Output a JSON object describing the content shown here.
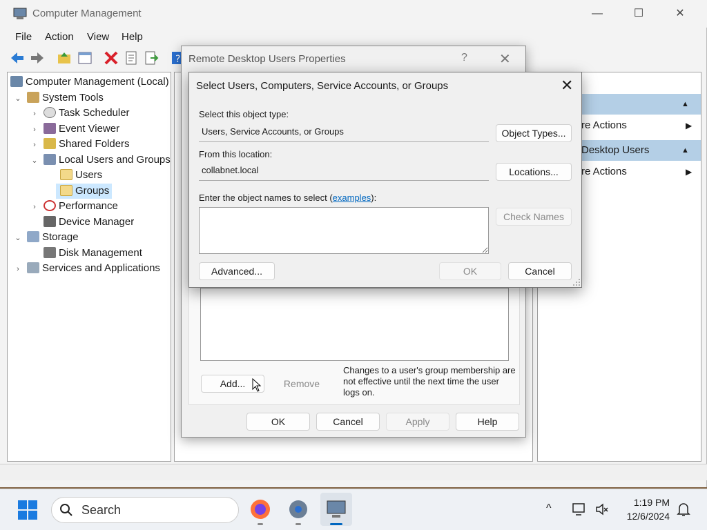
{
  "window": {
    "title": "Computer Management"
  },
  "menu": [
    "File",
    "Action",
    "View",
    "Help"
  ],
  "tree": [
    {
      "label": "Computer Management (Local)"
    },
    {
      "label": "System Tools"
    },
    {
      "label": "Task Scheduler"
    },
    {
      "label": "Event Viewer"
    },
    {
      "label": "Shared Folders"
    },
    {
      "label": "Local Users and Groups"
    },
    {
      "label": "Users"
    },
    {
      "label": "Groups"
    },
    {
      "label": "Performance"
    },
    {
      "label": "Device Manager"
    },
    {
      "label": "Storage"
    },
    {
      "label": "Disk Management"
    },
    {
      "label": "Services and Applications"
    }
  ],
  "actions": {
    "more1": "re Actions",
    "group": "Desktop Users",
    "more2": "re Actions"
  },
  "props": {
    "title": "Remote Desktop Users Properties",
    "help": "?",
    "add": "Add...",
    "remove": "Remove",
    "note": "Changes to a user's group membership are not effective until the next time the user logs on.",
    "ok": "OK",
    "cancel": "Cancel",
    "apply": "Apply",
    "helpbtn": "Help"
  },
  "select": {
    "title": "Select Users, Computers, Service Accounts, or Groups",
    "type_label": "Select this object type:",
    "type_value": "Users, Service Accounts, or Groups",
    "object_types": "Object Types...",
    "loc_label": "From this location:",
    "loc_value": "collabnet.local",
    "locations": "Locations...",
    "names_label_pre": "Enter the object names to select (",
    "names_label_link": "examples",
    "names_label_post": "):",
    "names_value": "",
    "check_names": "Check Names",
    "advanced": "Advanced...",
    "ok": "OK",
    "cancel": "Cancel"
  },
  "taskbar": {
    "search": "Search",
    "time": "1:19 PM",
    "date": "12/6/2024"
  }
}
